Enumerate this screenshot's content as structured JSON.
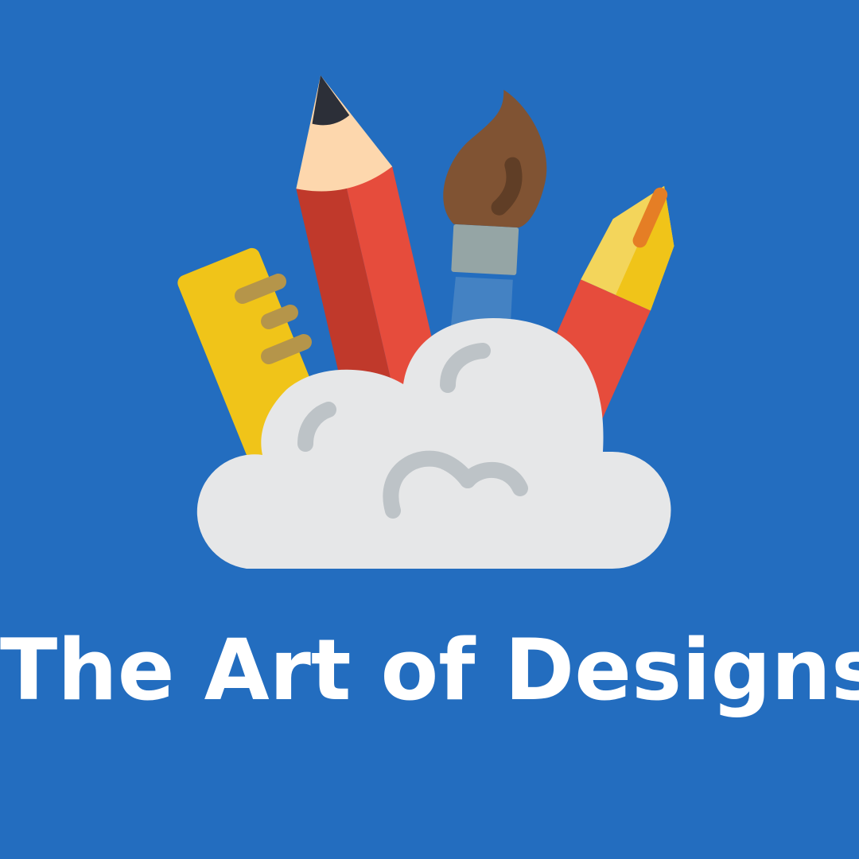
{
  "title": "The Art of Designs",
  "colors": {
    "background": "#236dbf",
    "title_text": "#ffffff",
    "cloud": "#e6e7e8",
    "cloud_lines": "#bdc3c7",
    "ruler": "#f0c419",
    "ruler_ticks": "#b5954a",
    "pencil_dark": "#c0392b",
    "pencil_light": "#e64c3c",
    "pencil_wood": "#fdd7ad",
    "pencil_lead": "#2c2f38",
    "brush_head": "#805333",
    "brush_head_shadow": "#603e26",
    "brush_ferrule": "#95a5a5",
    "brush_handle": "#4482c3",
    "pen_body": "#e64c3c",
    "pen_nib": "#f3d55b",
    "pen_nib_shadow": "#f0c419",
    "pen_slit": "#e57e25"
  },
  "icons": {
    "ruler": "ruler-icon",
    "pencil": "pencil-icon",
    "brush": "paintbrush-icon",
    "pen": "fountain-pen-icon",
    "cloud": "cloud-icon"
  }
}
